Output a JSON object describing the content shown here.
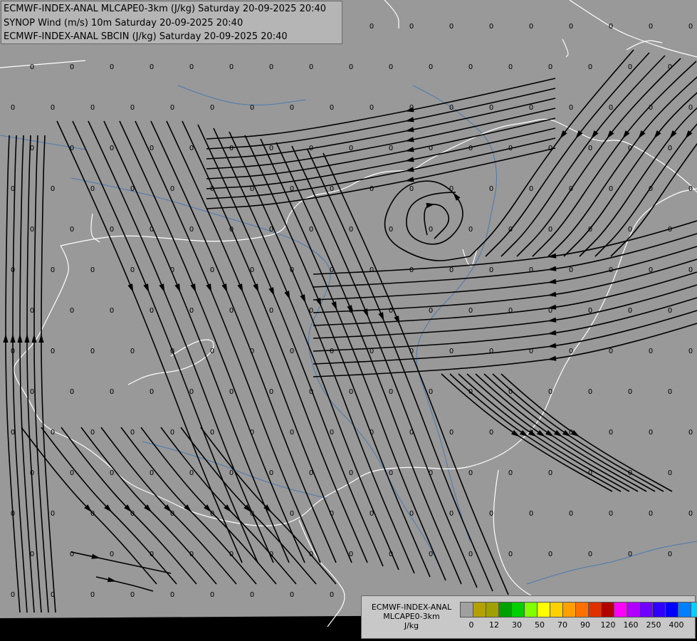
{
  "header": {
    "line1": "ECMWF-INDEX-ANAL MLCAPE0-3km (J/kg) Saturday 20-09-2025 20:40",
    "line2": "SYNOP Wind (m/s) 10m Saturday 20-09-2025 20:40",
    "line3": "ECMWF-INDEX-ANAL SBCIN (J/kg) Saturday 20-09-2025 20:40"
  },
  "legend": {
    "model": "ECMWF-INDEX-ANAL",
    "parameter": "MLCAPE0-3km",
    "unit": "J/kg",
    "swatch_colors": [
      "#a0a0a0",
      "#b4a000",
      "#a0a000",
      "#00a000",
      "#00d000",
      "#80ff00",
      "#ffff00",
      "#ffd000",
      "#ffa000",
      "#ff7000",
      "#e03000",
      "#b00000",
      "#ff00ff",
      "#b000ff",
      "#7000ff",
      "#3000ff",
      "#0000ff",
      "#0080ff",
      "#00d0ff",
      "#80ffff",
      "#ffffff"
    ],
    "tick_labels": [
      "0",
      "12",
      "30",
      "50",
      "70",
      "90",
      "120",
      "160",
      "250",
      "400"
    ]
  },
  "map": {
    "background_color": "#999999",
    "border_color": "#ffffff",
    "river_color": "#4a7ab0",
    "streamline_color": "#000000",
    "station_value": "0"
  }
}
